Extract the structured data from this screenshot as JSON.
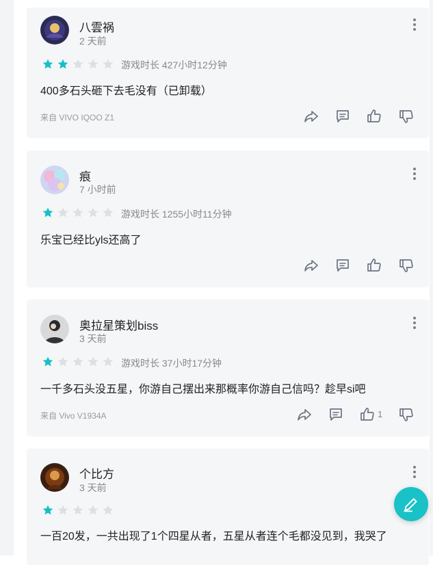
{
  "colors": {
    "star_on": "#14c0c6",
    "star_off": "#dcdfe3",
    "icon": "#6b7280",
    "fab": "#19c2c6",
    "card_bg": "#f5f6f8"
  },
  "reviews": [
    {
      "username": "八雲祸",
      "time": "2 天前",
      "rating": 2,
      "playtime": "游戏时长 427小时12分钟",
      "content": "400多石头砸下去毛没有（已卸载）",
      "device": "来自 VIVO IQOO Z1",
      "likes": ""
    },
    {
      "username": "痕",
      "time": "7 小时前",
      "rating": 1,
      "playtime": "游戏时长 1255小时11分钟",
      "content": "乐宝已经比yls还高了",
      "device": "",
      "likes": ""
    },
    {
      "username": "奥拉星策划biss",
      "time": "3 天前",
      "rating": 1,
      "playtime": "游戏时长 37小时17分钟",
      "content": "一千多石头没五星，你游自己摆出来那概率你游自己信吗？趁早si吧",
      "device": "来自 Vivo V1934A",
      "likes": "1"
    },
    {
      "username": "个比方",
      "time": "3 天前",
      "rating": 1,
      "playtime": "",
      "content": "一百20发，一共出现了1个四星从者，五星从者连个毛都没见到，我哭了",
      "device": "",
      "likes": ""
    }
  ],
  "icons": {
    "share": "share-icon",
    "reply": "comment-icon",
    "like": "thumbs-up-icon",
    "dislike": "thumbs-down-icon",
    "more": "more-vertical-icon",
    "write": "edit-pen-icon"
  }
}
